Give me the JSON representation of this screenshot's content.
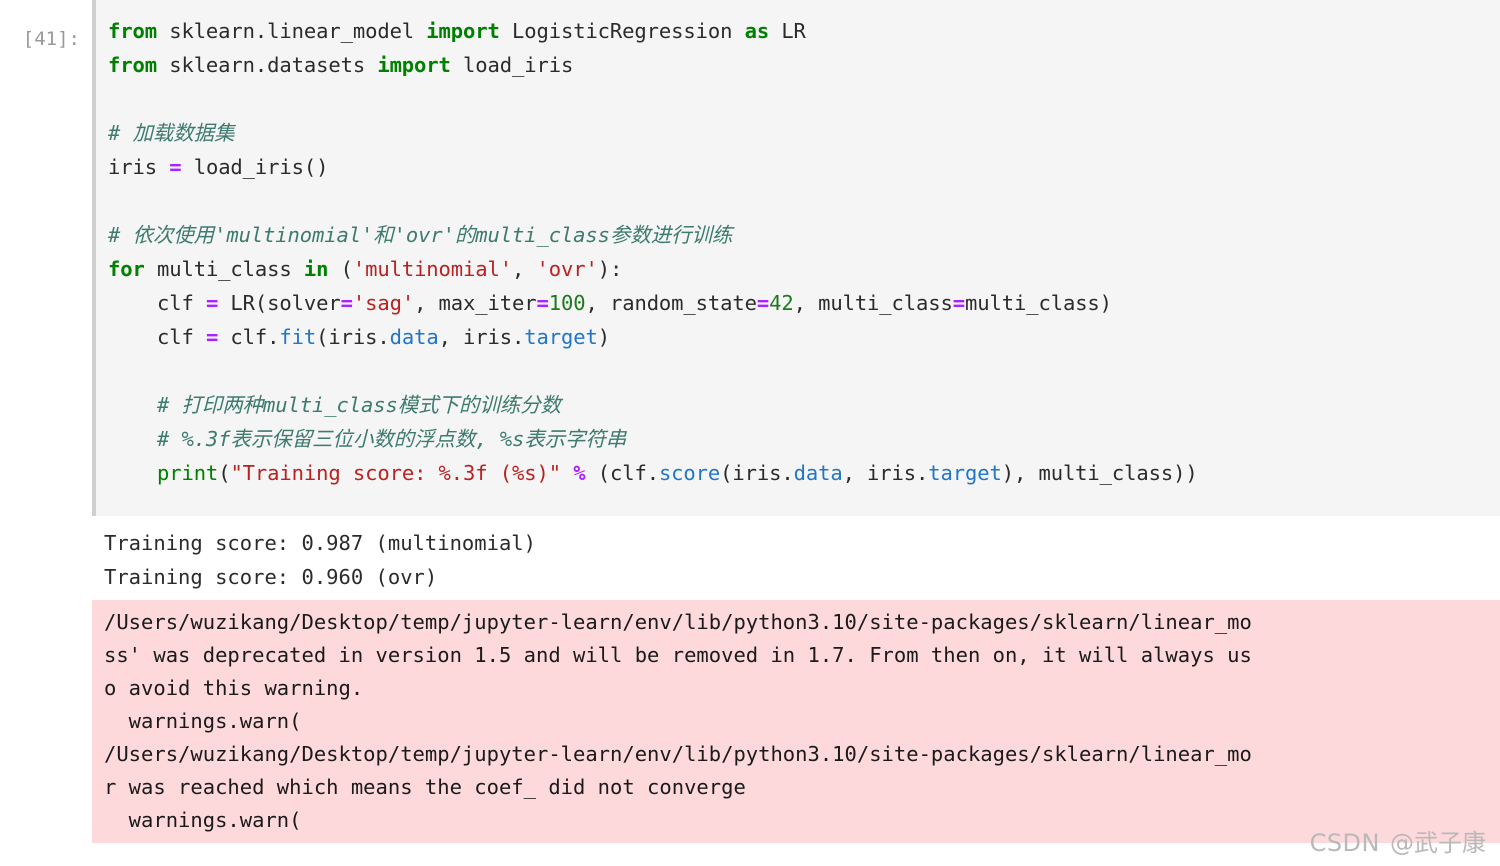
{
  "cell": {
    "prompt_label": "[41]:",
    "execution_count": 41,
    "language": "python",
    "code_lines": [
      [
        {
          "t": "from",
          "c": "kw"
        },
        {
          "t": " sklearn.linear_model ",
          "c": "pl"
        },
        {
          "t": "import",
          "c": "kw"
        },
        {
          "t": " LogisticRegression ",
          "c": "pl"
        },
        {
          "t": "as",
          "c": "kw"
        },
        {
          "t": " LR",
          "c": "pl"
        }
      ],
      [
        {
          "t": "from",
          "c": "kw"
        },
        {
          "t": " sklearn.datasets ",
          "c": "pl"
        },
        {
          "t": "import",
          "c": "kw"
        },
        {
          "t": " load_iris",
          "c": "pl"
        }
      ],
      [],
      [
        {
          "t": "# 加载数据集",
          "c": "cmt"
        }
      ],
      [
        {
          "t": "iris ",
          "c": "pl"
        },
        {
          "t": "=",
          "c": "op"
        },
        {
          "t": " load_iris()",
          "c": "pl"
        }
      ],
      [],
      [
        {
          "t": "# 依次使用'multinomial'和'ovr'的multi_class参数进行训练",
          "c": "cmt"
        }
      ],
      [
        {
          "t": "for",
          "c": "kw"
        },
        {
          "t": " multi_class ",
          "c": "pl"
        },
        {
          "t": "in",
          "c": "kw"
        },
        {
          "t": " (",
          "c": "pl"
        },
        {
          "t": "'multinomial'",
          "c": "str"
        },
        {
          "t": ", ",
          "c": "pl"
        },
        {
          "t": "'ovr'",
          "c": "str"
        },
        {
          "t": "):",
          "c": "pl"
        }
      ],
      [
        {
          "t": "    clf ",
          "c": "pl"
        },
        {
          "t": "=",
          "c": "op"
        },
        {
          "t": " LR(solver",
          "c": "pl"
        },
        {
          "t": "=",
          "c": "op"
        },
        {
          "t": "'sag'",
          "c": "str"
        },
        {
          "t": ", max_iter",
          "c": "pl"
        },
        {
          "t": "=",
          "c": "op"
        },
        {
          "t": "100",
          "c": "num"
        },
        {
          "t": ", random_state",
          "c": "pl"
        },
        {
          "t": "=",
          "c": "op"
        },
        {
          "t": "42",
          "c": "num"
        },
        {
          "t": ", multi_class",
          "c": "pl"
        },
        {
          "t": "=",
          "c": "op"
        },
        {
          "t": "multi_class)",
          "c": "pl"
        }
      ],
      [
        {
          "t": "    clf ",
          "c": "pl"
        },
        {
          "t": "=",
          "c": "op"
        },
        {
          "t": " clf.",
          "c": "pl"
        },
        {
          "t": "fit",
          "c": "attr"
        },
        {
          "t": "(iris.",
          "c": "pl"
        },
        {
          "t": "data",
          "c": "attr"
        },
        {
          "t": ", iris.",
          "c": "pl"
        },
        {
          "t": "target",
          "c": "attr"
        },
        {
          "t": ")",
          "c": "pl"
        }
      ],
      [],
      [
        {
          "t": "    # 打印两种multi_class模式下的训练分数",
          "c": "cmt"
        }
      ],
      [
        {
          "t": "    # %.3f表示保留三位小数的浮点数, %s表示字符串",
          "c": "cmt"
        }
      ],
      [
        {
          "t": "    ",
          "c": "pl"
        },
        {
          "t": "print",
          "c": "bif"
        },
        {
          "t": "(",
          "c": "pl"
        },
        {
          "t": "\"Training score: %.3f (%s)\"",
          "c": "str"
        },
        {
          "t": " ",
          "c": "pl"
        },
        {
          "t": "%",
          "c": "op"
        },
        {
          "t": " (clf.",
          "c": "pl"
        },
        {
          "t": "score",
          "c": "attr"
        },
        {
          "t": "(iris.",
          "c": "pl"
        },
        {
          "t": "data",
          "c": "attr"
        },
        {
          "t": ", iris.",
          "c": "pl"
        },
        {
          "t": "target",
          "c": "attr"
        },
        {
          "t": "), multi_class))",
          "c": "pl"
        }
      ]
    ],
    "code_plain": "from sklearn.linear_model import LogisticRegression as LR\nfrom sklearn.datasets import load_iris\n\n# 加载数据集\niris = load_iris()\n\n# 依次使用'multinomial'和'ovr'的multi_class参数进行训练\nfor multi_class in ('multinomial', 'ovr'):\n    clf = LR(solver='sag', max_iter=100, random_state=42, multi_class=multi_class)\n    clf = clf.fit(iris.data, iris.target)\n\n    # 打印两种multi_class模式下的训练分数\n    # %.3f表示保留三位小数的浮点数, %s表示字符串\n    print(\"Training score: %.3f (%s)\" % (clf.score(iris.data, iris.target), multi_class))"
  },
  "output": {
    "stdout_text": "Training score: 0.987 (multinomial)\nTraining score: 0.960 (ovr)",
    "stdout_lines": [
      "Training score: 0.987 (multinomial)",
      "Training score: 0.960 (ovr)"
    ],
    "scores": [
      {
        "label": "multinomial",
        "value": "0.987"
      },
      {
        "label": "ovr",
        "value": "0.960"
      }
    ],
    "stderr_text": "/Users/wuzikang/Desktop/temp/jupyter-learn/env/lib/python3.10/site-packages/sklearn/linear_mo\nss' was deprecated in version 1.5 and will be removed in 1.7. From then on, it will always us\no avoid this warning.\n  warnings.warn(\n/Users/wuzikang/Desktop/temp/jupyter-learn/env/lib/python3.10/site-packages/sklearn/linear_mo\nr was reached which means the coef_ did not converge\n  warnings.warn(",
    "stderr_lines": [
      "/Users/wuzikang/Desktop/temp/jupyter-learn/env/lib/python3.10/site-packages/sklearn/linear_mo",
      "ss' was deprecated in version 1.5 and will be removed in 1.7. From then on, it will always us",
      "o avoid this warning.",
      "  warnings.warn(",
      "/Users/wuzikang/Desktop/temp/jupyter-learn/env/lib/python3.10/site-packages/sklearn/linear_mo",
      "r was reached which means the coef_ did not converge",
      "  warnings.warn("
    ]
  },
  "watermark": {
    "brand": "CSDN",
    "user": "@武子康"
  },
  "colors": {
    "cell_background": "#f5f5f5",
    "cell_border": "#cfcfcf",
    "stderr_background": "#fdd9dc",
    "keyword": "#008000",
    "string": "#ba2121",
    "number": "#1b7a1b",
    "operator": "#aa22ff",
    "attribute": "#2176c7",
    "comment": "#3d7b6f",
    "prompt": "#999999",
    "text": "#2b2b2b"
  }
}
